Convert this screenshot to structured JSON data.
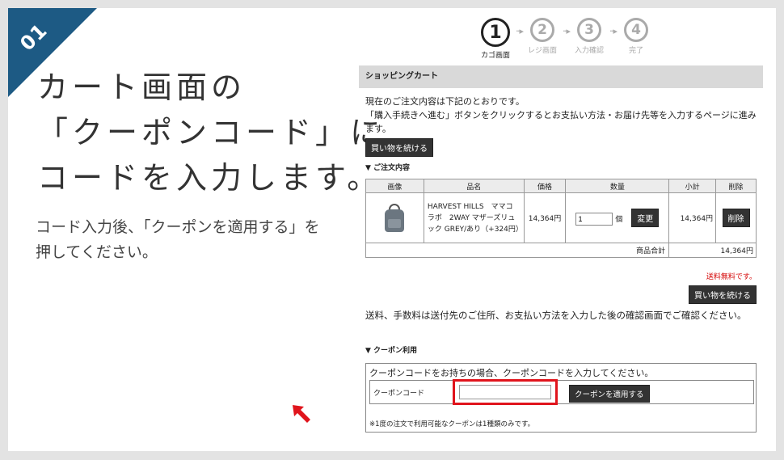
{
  "ribbon": {
    "number": "01"
  },
  "headline": [
    "カート画面の",
    "「クーポンコード」に",
    "コードを入力します。"
  ],
  "description": "コード入力後、「クーポンを適用する」を押してください。",
  "steps": [
    {
      "num": "1",
      "label": "カゴ画面"
    },
    {
      "num": "2",
      "label": "レジ画面"
    },
    {
      "num": "3",
      "label": "入力確認"
    },
    {
      "num": "4",
      "label": "完了"
    }
  ],
  "cart": {
    "title": "ショッピングカート",
    "intro_line1": "現在のご注文内容は下記のとおりです。",
    "intro_line2": "「購入手続きへ進む」ボタンをクリックするとお支払い方法・お届け先等を入力するページに進みます。",
    "continue_label": "買い物を続ける",
    "order_section": "▼ ご注文内容",
    "columns": [
      "画像",
      "品名",
      "価格",
      "数量",
      "小計",
      "削除"
    ],
    "item": {
      "name": "HARVEST HILLS　ママコラボ　2WAY マザーズリュック GREY/あり（+324円）",
      "price": "14,364円",
      "qty": "1",
      "qty_unit": "個",
      "change_label": "変更",
      "subtotal": "14,364円",
      "delete_label": "削除"
    },
    "total_label": "商品合計",
    "total_value": "14,364円",
    "free_shipping": "送料無料です。",
    "continue_label2": "買い物を続ける",
    "shipping_notice": "送料、手数料は送付先のご住所、お支払い方法を入力した後の確認画面でご確認ください。"
  },
  "coupon": {
    "section": "▼ クーポン利用",
    "message": "クーポンコードをお持ちの場合、クーポンコードを入力してください。",
    "label": "クーポンコード",
    "value": "",
    "apply_label": "クーポンを適用する",
    "note": "※1度の注文で利用可能なクーポンは1種類のみです。"
  },
  "colors": {
    "ribbon": "#1d5a84",
    "highlight": "#e0141c",
    "button": "#333333"
  }
}
